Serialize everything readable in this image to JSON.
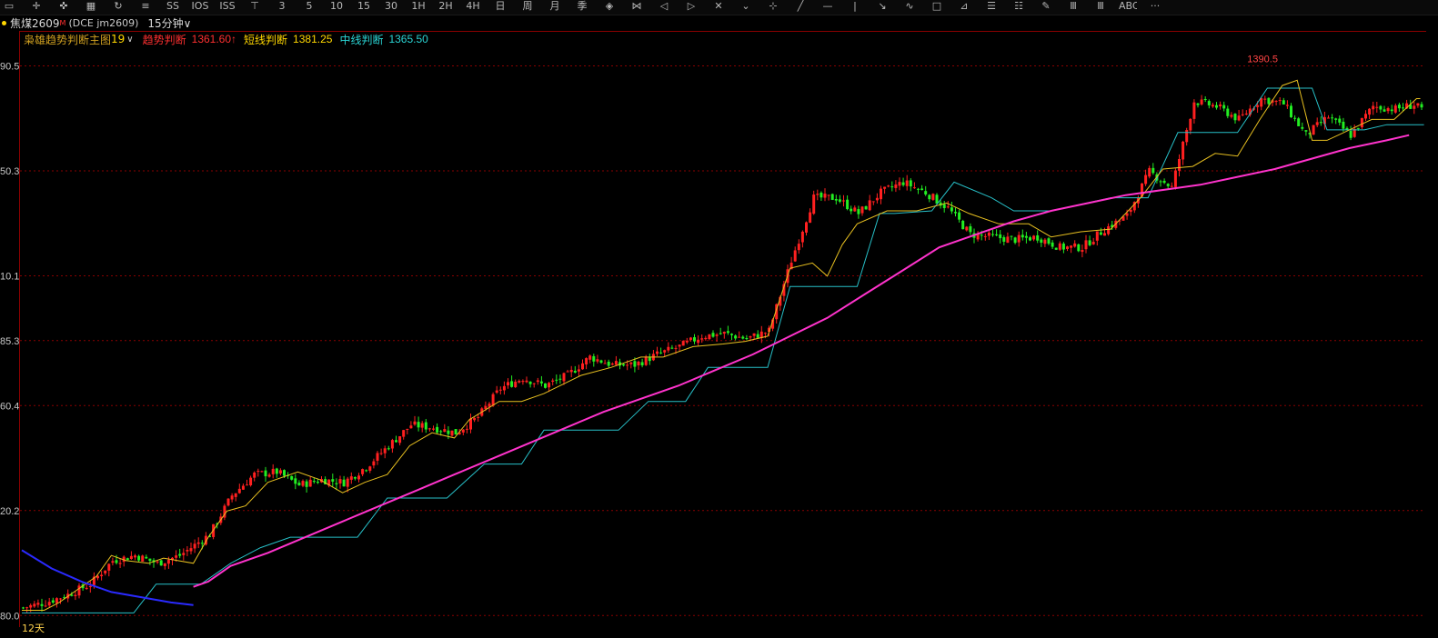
{
  "toolbar": {
    "icons": [
      {
        "name": "line-tool-icon",
        "glyph": "▭"
      },
      {
        "name": "crosshair-icon",
        "glyph": "✛"
      },
      {
        "name": "cross-arrows-icon",
        "glyph": "✜"
      },
      {
        "name": "grid-icon",
        "glyph": "▦"
      },
      {
        "name": "refresh-icon",
        "glyph": "↻"
      },
      {
        "name": "stack-icon",
        "glyph": "≡"
      },
      {
        "name": "ss-icon",
        "glyph": "SS"
      },
      {
        "name": "ios-icon",
        "glyph": "IOS"
      },
      {
        "name": "iss-icon",
        "glyph": "ISS"
      },
      {
        "name": "t1-icon",
        "glyph": "⊤"
      },
      {
        "name": "t3-icon",
        "glyph": "3"
      },
      {
        "name": "t5-icon",
        "glyph": "5"
      },
      {
        "name": "t10-icon",
        "glyph": "10"
      },
      {
        "name": "t15-icon",
        "glyph": "15"
      },
      {
        "name": "t30-icon",
        "glyph": "30"
      },
      {
        "name": "1h-icon",
        "glyph": "1H"
      },
      {
        "name": "2h-icon",
        "glyph": "2H"
      },
      {
        "name": "4h-icon",
        "glyph": "4H"
      },
      {
        "name": "day-icon",
        "glyph": "日"
      },
      {
        "name": "week-icon",
        "glyph": "周"
      },
      {
        "name": "month-icon",
        "glyph": "月"
      },
      {
        "name": "season-icon",
        "glyph": "季"
      },
      {
        "name": "diamond-icon",
        "glyph": "◈"
      },
      {
        "name": "bowtie-icon",
        "glyph": "⋈"
      },
      {
        "name": "left-arrow-icon",
        "glyph": "◁"
      },
      {
        "name": "right-arrow-icon",
        "glyph": "▷"
      },
      {
        "name": "x-icon",
        "glyph": "✕"
      },
      {
        "name": "chevron-icon",
        "glyph": "⌄"
      },
      {
        "name": "plus-icon",
        "glyph": "⊹"
      },
      {
        "name": "diag-line-icon",
        "glyph": "╱"
      },
      {
        "name": "hline-icon",
        "glyph": "—"
      },
      {
        "name": "vline-icon",
        "glyph": "|"
      },
      {
        "name": "ray-icon",
        "glyph": "↘"
      },
      {
        "name": "wave-icon",
        "glyph": "∿"
      },
      {
        "name": "rect-icon",
        "glyph": "□"
      },
      {
        "name": "slash-box-icon",
        "glyph": "⊿"
      },
      {
        "name": "fib-icon",
        "glyph": "☰"
      },
      {
        "name": "layers-icon",
        "glyph": "☷"
      },
      {
        "name": "pen-icon",
        "glyph": "✎"
      },
      {
        "name": "bars-icon",
        "glyph": "Ⅲ"
      },
      {
        "name": "bars2-icon",
        "glyph": "Ⅲ"
      },
      {
        "name": "text-icon",
        "glyph": "ABC"
      },
      {
        "name": "more-icon",
        "glyph": "···"
      }
    ]
  },
  "info": {
    "symbol": "焦煤2609",
    "sup": "M",
    "exchange": "(DCE  jm2609)",
    "period": "15分钟∨"
  },
  "indicator": {
    "name": "枭雄趋势判断主图",
    "name_num": "19",
    "trend_label": "趋势判断",
    "trend_value": "1361.60↑",
    "short_label": "短线判断",
    "short_value": "1381.25",
    "mid_label": "中线判断",
    "mid_value": "1365.50"
  },
  "colors": {
    "up": "#ff2020",
    "down": "#22ee22",
    "short_line": "#e8c020",
    "mid_line": "#27c0c8",
    "ma_line": "#ff33cc",
    "ma_blue": "#2a2aff",
    "grid": "#8a0000",
    "axis_text": "#c8c8c8",
    "high_label": "#ff4444",
    "trend_color": "#ff3030",
    "short_color": "#ffd700",
    "mid_color": "#2ad4d4"
  },
  "period_label": "12天",
  "high_label": "1390.5",
  "chart_data": {
    "type": "candlestick",
    "y_ticks": [
      {
        "value": 1390.5,
        "label": "90.5"
      },
      {
        "value": 1350.3,
        "label": "50.3"
      },
      {
        "value": 1310.1,
        "label": "10.1"
      },
      {
        "value": 1285.3,
        "label": "85.3"
      },
      {
        "value": 1260.4,
        "label": "60.4"
      },
      {
        "value": 1220.2,
        "label": "20.2"
      },
      {
        "value": 1180.0,
        "label": "80.0"
      }
    ],
    "ylim": [
      1178,
      1398
    ],
    "anchors": [
      [
        0,
        1183
      ],
      [
        6,
        1185
      ],
      [
        12,
        1188
      ],
      [
        18,
        1192
      ],
      [
        24,
        1201
      ],
      [
        30,
        1203
      ],
      [
        36,
        1200
      ],
      [
        42,
        1203
      ],
      [
        50,
        1211
      ],
      [
        56,
        1226
      ],
      [
        62,
        1234
      ],
      [
        68,
        1235
      ],
      [
        74,
        1230
      ],
      [
        80,
        1232
      ],
      [
        86,
        1231
      ],
      [
        92,
        1237
      ],
      [
        98,
        1245
      ],
      [
        104,
        1253
      ],
      [
        110,
        1252
      ],
      [
        116,
        1250
      ],
      [
        122,
        1256
      ],
      [
        128,
        1267
      ],
      [
        134,
        1271
      ],
      [
        140,
        1268
      ],
      [
        146,
        1272
      ],
      [
        152,
        1279
      ],
      [
        158,
        1276
      ],
      [
        164,
        1276
      ],
      [
        170,
        1280
      ],
      [
        176,
        1283
      ],
      [
        182,
        1287
      ],
      [
        188,
        1288
      ],
      [
        194,
        1286
      ],
      [
        200,
        1289
      ],
      [
        206,
        1316
      ],
      [
        212,
        1340
      ],
      [
        218,
        1340
      ],
      [
        224,
        1334
      ],
      [
        230,
        1342
      ],
      [
        236,
        1346
      ],
      [
        242,
        1342
      ],
      [
        248,
        1336
      ],
      [
        254,
        1326
      ],
      [
        260,
        1325
      ],
      [
        266,
        1324
      ],
      [
        272,
        1325
      ],
      [
        278,
        1321
      ],
      [
        284,
        1321
      ],
      [
        290,
        1328
      ],
      [
        296,
        1333
      ],
      [
        302,
        1350
      ],
      [
        308,
        1344
      ],
      [
        314,
        1377
      ],
      [
        320,
        1375
      ],
      [
        326,
        1370
      ],
      [
        332,
        1378
      ],
      [
        338,
        1376
      ],
      [
        344,
        1364
      ],
      [
        350,
        1371
      ],
      [
        356,
        1364
      ],
      [
        362,
        1375
      ],
      [
        368,
        1374
      ],
      [
        374,
        1376
      ],
      [
        375,
        1373
      ]
    ],
    "short_line": [
      [
        0,
        1182
      ],
      [
        6,
        1182
      ],
      [
        10,
        1185
      ],
      [
        14,
        1189
      ],
      [
        20,
        1195
      ],
      [
        24,
        1203
      ],
      [
        28,
        1201
      ],
      [
        34,
        1200
      ],
      [
        38,
        1202
      ],
      [
        46,
        1200
      ],
      [
        50,
        1210
      ],
      [
        55,
        1220
      ],
      [
        60,
        1222
      ],
      [
        66,
        1231
      ],
      [
        74,
        1235
      ],
      [
        80,
        1232
      ],
      [
        86,
        1227
      ],
      [
        92,
        1231
      ],
      [
        98,
        1234
      ],
      [
        104,
        1245
      ],
      [
        110,
        1250
      ],
      [
        116,
        1248
      ],
      [
        120,
        1255
      ],
      [
        128,
        1262
      ],
      [
        134,
        1262
      ],
      [
        140,
        1265
      ],
      [
        150,
        1272
      ],
      [
        158,
        1275
      ],
      [
        166,
        1279
      ],
      [
        172,
        1279
      ],
      [
        180,
        1283
      ],
      [
        188,
        1284
      ],
      [
        194,
        1285
      ],
      [
        200,
        1287
      ],
      [
        206,
        1313
      ],
      [
        212,
        1315
      ],
      [
        216,
        1310
      ],
      [
        220,
        1322
      ],
      [
        224,
        1330
      ],
      [
        232,
        1335
      ],
      [
        240,
        1335
      ],
      [
        248,
        1338
      ],
      [
        254,
        1334
      ],
      [
        262,
        1330
      ],
      [
        270,
        1330
      ],
      [
        276,
        1325
      ],
      [
        284,
        1327
      ],
      [
        292,
        1328
      ],
      [
        300,
        1340
      ],
      [
        306,
        1351
      ],
      [
        314,
        1352
      ],
      [
        320,
        1357
      ],
      [
        326,
        1356
      ],
      [
        332,
        1370
      ],
      [
        338,
        1383
      ],
      [
        342,
        1385
      ],
      [
        346,
        1362
      ],
      [
        350,
        1362
      ],
      [
        356,
        1366
      ],
      [
        362,
        1370
      ],
      [
        368,
        1370
      ],
      [
        374,
        1378
      ],
      [
        375,
        1378
      ]
    ],
    "mid_line": [
      [
        0,
        1181
      ],
      [
        30,
        1181
      ],
      [
        36,
        1192
      ],
      [
        48,
        1192
      ],
      [
        56,
        1200
      ],
      [
        64,
        1206
      ],
      [
        72,
        1210
      ],
      [
        90,
        1210
      ],
      [
        98,
        1225
      ],
      [
        114,
        1225
      ],
      [
        124,
        1238
      ],
      [
        134,
        1238
      ],
      [
        140,
        1251
      ],
      [
        160,
        1251
      ],
      [
        168,
        1262
      ],
      [
        178,
        1262
      ],
      [
        184,
        1275
      ],
      [
        200,
        1275
      ],
      [
        206,
        1306
      ],
      [
        224,
        1306
      ],
      [
        230,
        1334
      ],
      [
        234,
        1334
      ],
      [
        244,
        1335
      ],
      [
        250,
        1346
      ],
      [
        260,
        1340
      ],
      [
        266,
        1335
      ],
      [
        276,
        1335
      ],
      [
        292,
        1340
      ],
      [
        302,
        1340
      ],
      [
        310,
        1365
      ],
      [
        326,
        1365
      ],
      [
        334,
        1382
      ],
      [
        346,
        1382
      ],
      [
        350,
        1366
      ],
      [
        360,
        1366
      ],
      [
        366,
        1368
      ],
      [
        376,
        1368
      ]
    ],
    "ma_line": [
      [
        46,
        1191
      ],
      [
        50,
        1193
      ],
      [
        56,
        1199
      ],
      [
        66,
        1204
      ],
      [
        76,
        1210
      ],
      [
        86,
        1216
      ],
      [
        96,
        1222
      ],
      [
        106,
        1228
      ],
      [
        116,
        1234
      ],
      [
        126,
        1240
      ],
      [
        136,
        1246
      ],
      [
        146,
        1252
      ],
      [
        156,
        1258
      ],
      [
        166,
        1263
      ],
      [
        176,
        1268
      ],
      [
        186,
        1274
      ],
      [
        196,
        1280
      ],
      [
        206,
        1287
      ],
      [
        216,
        1294
      ],
      [
        226,
        1303
      ],
      [
        236,
        1312
      ],
      [
        246,
        1321
      ],
      [
        256,
        1326
      ],
      [
        266,
        1331
      ],
      [
        276,
        1335
      ],
      [
        286,
        1338
      ],
      [
        296,
        1341
      ],
      [
        306,
        1343
      ],
      [
        316,
        1345
      ],
      [
        326,
        1348
      ],
      [
        336,
        1351
      ],
      [
        346,
        1355
      ],
      [
        356,
        1359
      ],
      [
        366,
        1362
      ],
      [
        372,
        1364
      ]
    ],
    "ma_blue": [
      [
        0,
        1205
      ],
      [
        8,
        1198
      ],
      [
        16,
        1193
      ],
      [
        24,
        1189
      ],
      [
        32,
        1187
      ],
      [
        40,
        1185
      ],
      [
        46,
        1184
      ]
    ],
    "high_point": {
      "index": 333,
      "value": 1390.5
    }
  }
}
